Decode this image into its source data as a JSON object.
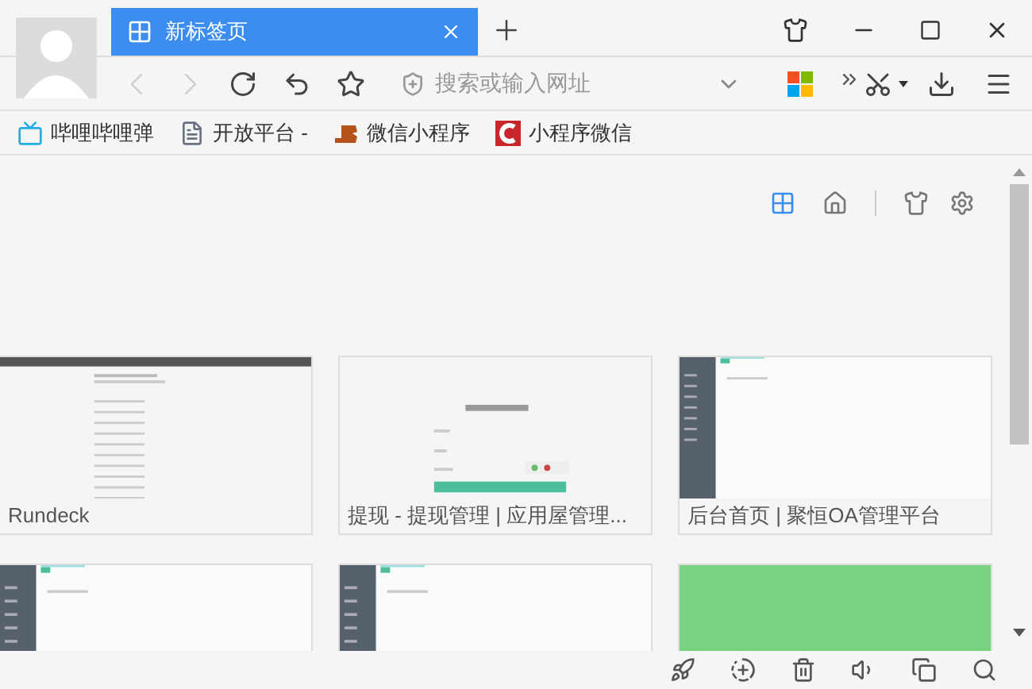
{
  "tab": {
    "title": "新标签页",
    "selected": true
  },
  "address": {
    "placeholder": "搜索或输入网址"
  },
  "bookmarks": [
    {
      "label": "哔哩哔哩弹",
      "kind": "tv"
    },
    {
      "label": "开放平台 -",
      "kind": "page"
    },
    {
      "label": "微信小程序",
      "kind": "jb"
    },
    {
      "label": "小程序微信",
      "kind": "c"
    }
  ],
  "tiles": [
    {
      "kind": "rundeck",
      "caption": "Rundeck"
    },
    {
      "kind": "login",
      "caption": "提现 - 提现管理 | 应用屋管理..."
    },
    {
      "kind": "admin",
      "caption": "后台首页 | 聚恒OA管理平台"
    },
    {
      "kind": "admin"
    },
    {
      "kind": "admin"
    },
    {
      "kind": "globe"
    }
  ]
}
